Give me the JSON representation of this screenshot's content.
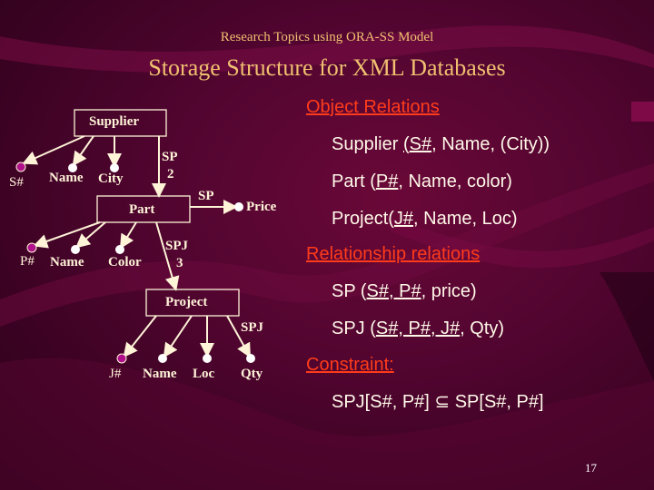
{
  "slide": {
    "subtitle": "Research Topics using ORA-SS Model",
    "title": "Storage Structure for XML Databases",
    "page_number": "17"
  },
  "diagram": {
    "objects": {
      "supplier": "Supplier",
      "part": "Part",
      "project": "Project"
    },
    "attributes": {
      "supplier_key": "S#",
      "supplier_name": "Name",
      "supplier_city": "City",
      "part_key": "P#",
      "part_name": "Name",
      "part_color": "Color",
      "sp_price": "Price",
      "project_key": "J#",
      "project_name": "Name",
      "project_loc": "Loc",
      "spj_qty": "Qty"
    },
    "relationships": {
      "sp_name": "SP",
      "sp_degree": "2",
      "sp_edge_label": "SP",
      "spj_name": "SPJ",
      "spj_degree": "3",
      "spj_edge_label": "SPJ"
    },
    "colors": {
      "key_attribute": "#b0108a",
      "attribute": "#ffffff",
      "line": "#fff4d8"
    }
  },
  "relations": {
    "object_heading": "Object Relations",
    "supplier": {
      "name": "Supplier ",
      "open": "(",
      "key": "S#",
      "rest": ", Name, (City))"
    },
    "part": {
      "name": "Part (",
      "key": "P#",
      "rest": ", Name, color)"
    },
    "project": {
      "name": "Project(",
      "key": "J#",
      "rest": ", Name, Loc)"
    },
    "relationship_heading": "Relationship relations",
    "sp": {
      "name": "SP (",
      "key": "S#, P#",
      "rest": ", price)"
    },
    "spj": {
      "name": "SPJ (",
      "key": "S#, P#, J#",
      "rest": ", Qty)"
    },
    "constraint_heading": "Constraint:",
    "constraint": "SPJ[S#, P#] ⊆ SP[S#, P#]",
    "colors": {
      "heading": "#ff3b1a",
      "text": "#fff8e8"
    }
  }
}
